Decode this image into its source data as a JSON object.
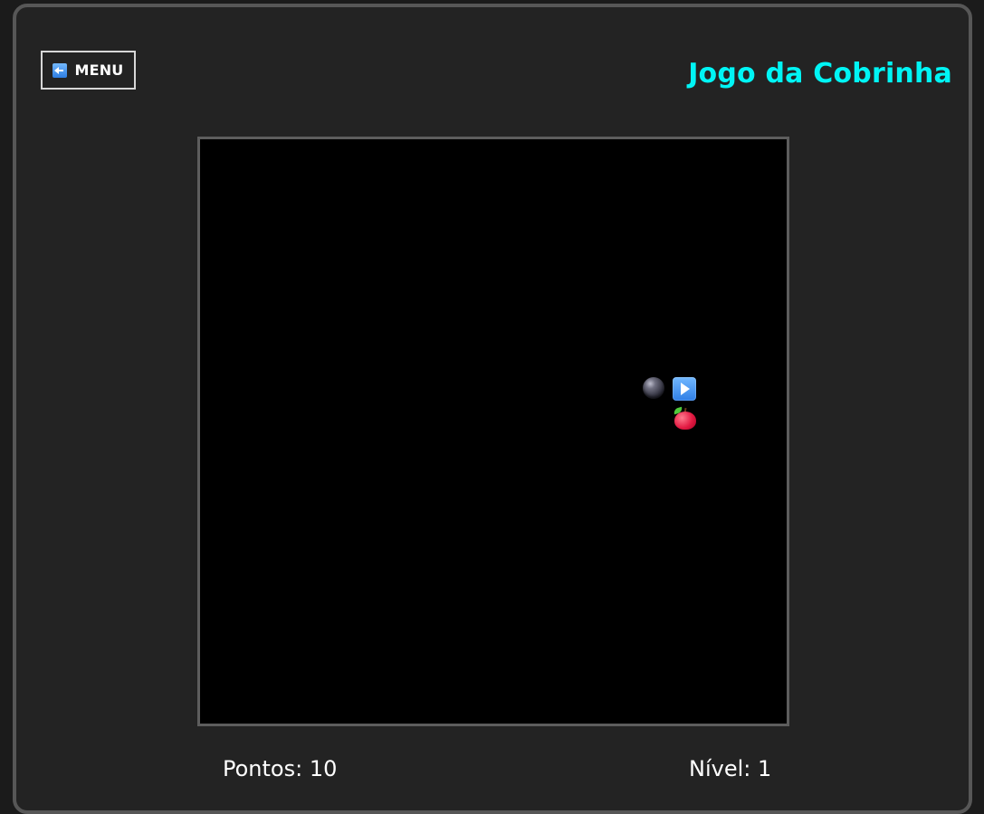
{
  "header": {
    "menu_label": "MENU",
    "title": "Jogo da Cobrinha",
    "menu_icon": "back-arrow-icon",
    "title_color": "#00f5f5"
  },
  "board": {
    "background": "#000000",
    "items": [
      {
        "name": "snake-body-segment",
        "icon": "black-circle-icon"
      },
      {
        "name": "snake-head",
        "icon": "play-arrow-icon"
      },
      {
        "name": "apple",
        "icon": "apple-icon"
      }
    ]
  },
  "footer": {
    "score_label": "Pontos: 10",
    "level_label": "Nível: 1"
  }
}
